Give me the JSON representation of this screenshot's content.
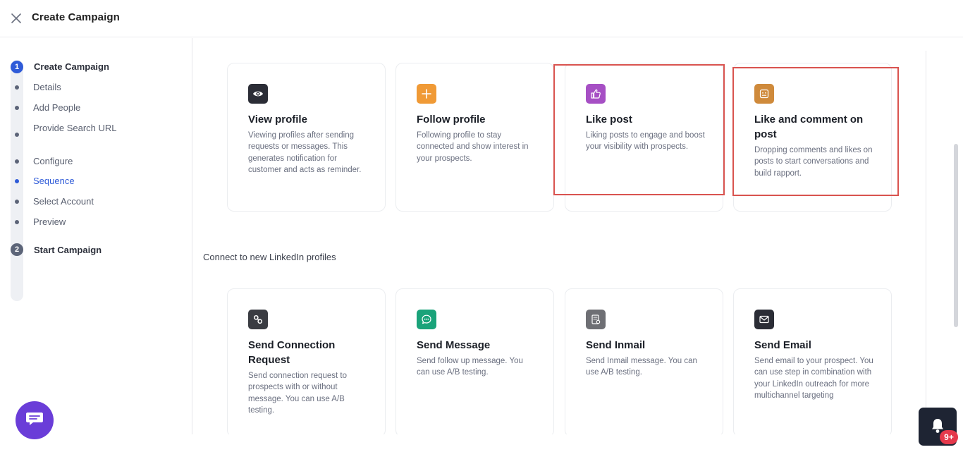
{
  "header": {
    "title": "Create Campaign",
    "close_icon": "close-icon"
  },
  "stepper": {
    "steps": [
      {
        "number": "1",
        "label": "Create Campaign",
        "state": "active"
      },
      {
        "number": "2",
        "label": "Start Campaign",
        "state": "inactive"
      }
    ],
    "substeps": [
      {
        "label": "Details"
      },
      {
        "label": "Add People"
      },
      {
        "label": "Provide Search URL"
      },
      {
        "label": "Configure"
      },
      {
        "label": "Sequence",
        "current": true
      },
      {
        "label": "Select Account"
      },
      {
        "label": "Preview"
      }
    ]
  },
  "engagement_cards": [
    {
      "title": "View profile",
      "description": "Viewing profiles after sending requests or messages. This generates notification for customer and acts as reminder.",
      "icon": "eye-icon",
      "icon_color": "#2b2d36"
    },
    {
      "title": "Follow profile",
      "description": "Following profile to stay connected and show interest in your prospects.",
      "icon": "plus-icon",
      "icon_color": "#f09a36"
    },
    {
      "title": "Like post",
      "description": "Liking posts to engage and boost your visibility with prospects.",
      "icon": "thumbs-up-icon",
      "icon_color": "#a64fc4"
    },
    {
      "title": "Like and comment on post",
      "description": "Dropping comments and likes on posts to start conversations and build rapport.",
      "icon": "comment-face-icon",
      "icon_color": "#cf8a3b"
    }
  ],
  "section_label": "Connect to new LinkedIn profiles",
  "connect_cards": [
    {
      "title": "Send Connection Request",
      "description": "Send connection request to prospects with or without message. You can use A/B testing.",
      "icon": "link-icon",
      "icon_color": "#3a3c42"
    },
    {
      "title": "Send Message",
      "description": "Send follow up message. You can use A/B testing.",
      "icon": "chat-bubble-icon",
      "icon_color": "#1aa37a"
    },
    {
      "title": "Send Inmail",
      "description": "Send Inmail message. You can use A/B testing.",
      "icon": "inmail-icon",
      "icon_color": "#6e6f74"
    },
    {
      "title": "Send Email",
      "description": "Send email to your prospect. You can use step in combination with your LinkedIn outreach for more multichannel targeting",
      "icon": "envelope-icon",
      "icon_color": "#2b2d36"
    }
  ],
  "chat_fab": {
    "icon": "chat-icon",
    "color": "#6a3dd8"
  },
  "notifications": {
    "icon": "bell-icon",
    "badge": "9+",
    "badge_color": "#e5394c"
  },
  "highlight_color": "#d9534f"
}
